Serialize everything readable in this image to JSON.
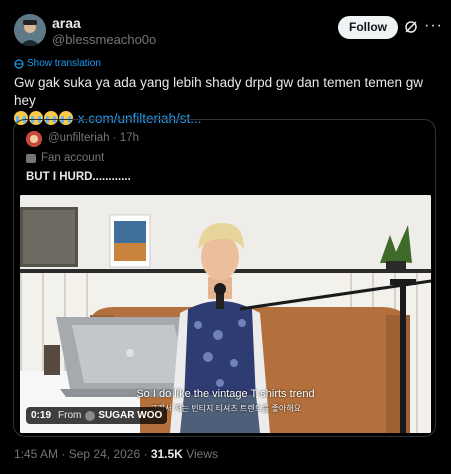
{
  "author": {
    "name": "araa",
    "handle": "@blessmeacho0o",
    "follow_label": "Follow",
    "icons": [
      "grok-icon",
      "more-icon"
    ]
  },
  "tweet": {
    "translate_label": "Show translation",
    "text": "Gw gak suka ya ada yang lebih shady drpd gw dan temen temen gw hey",
    "emoji_count": 4,
    "link": "x.com/unfilteriah/st..."
  },
  "quote": {
    "handle": "@unfilteriah",
    "separator": "·",
    "time": "17h",
    "account_label": "Fan account",
    "text": "BUT I HURD............",
    "video": {
      "caption_en": "So I do like the vintage T-shirts trend",
      "caption_ko": "그래서 저는 빈티지 티셔츠 트렌드를 좋아해요",
      "duration": "0:19",
      "from_label": "From",
      "source": "SUGAR WOO"
    }
  },
  "meta": {
    "time": "1:45 AM",
    "dot": "·",
    "date": "Sep 24, 2026",
    "views_count": "31.5K",
    "views_label": "Views"
  },
  "colors": {
    "background": "#000000",
    "text": "#e7e9ea",
    "secondary": "#71767b",
    "link": "#1d9bf0",
    "border": "#2f3336"
  }
}
